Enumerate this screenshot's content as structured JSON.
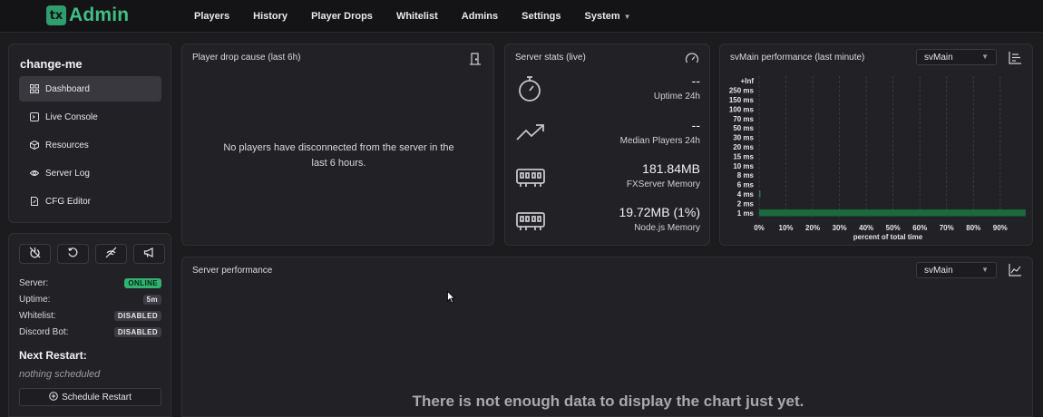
{
  "brand": {
    "mark": "tx",
    "name": "Admin",
    "color": "#3fbf85"
  },
  "nav": [
    {
      "label": "Players"
    },
    {
      "label": "History"
    },
    {
      "label": "Player Drops"
    },
    {
      "label": "Whitelist"
    },
    {
      "label": "Admins"
    },
    {
      "label": "Settings"
    },
    {
      "label": "System",
      "has_dropdown": true
    }
  ],
  "sidebar": {
    "server_name": "change-me",
    "items": [
      {
        "label": "Dashboard",
        "icon": "dashboard-icon",
        "active": true
      },
      {
        "label": "Live Console",
        "icon": "console-icon"
      },
      {
        "label": "Resources",
        "icon": "cube-icon"
      },
      {
        "label": "Server Log",
        "icon": "eye-icon"
      },
      {
        "label": "CFG Editor",
        "icon": "file-edit-icon"
      }
    ]
  },
  "status": {
    "controls": [
      "power-off-icon",
      "restart-icon",
      "signal-off-icon",
      "megaphone-icon"
    ],
    "rows": [
      {
        "label": "Server:",
        "value": "ONLINE",
        "style": "online"
      },
      {
        "label": "Uptime:",
        "value": "5m",
        "style": "gray"
      },
      {
        "label": "Whitelist:",
        "value": "DISABLED",
        "style": "gray"
      },
      {
        "label": "Discord Bot:",
        "value": "DISABLED",
        "style": "gray"
      }
    ],
    "next_restart_title": "Next Restart:",
    "next_restart_value": "nothing scheduled",
    "schedule_button": "Schedule Restart"
  },
  "drops": {
    "title": "Player drop cause (last 6h)",
    "empty_message": "No players have disconnected from the server in the last 6 hours."
  },
  "stats": {
    "title": "Server stats (live)",
    "items": [
      {
        "value": "--",
        "label": "Uptime 24h",
        "icon": "stopwatch-icon"
      },
      {
        "value": "--",
        "label": "Median Players 24h",
        "icon": "trending-up-icon"
      },
      {
        "value": "181.84MB",
        "label": "FXServer Memory",
        "icon": "memory-icon"
      },
      {
        "value": "19.72MB (1%)",
        "label": "Node.js Memory",
        "icon": "memory-icon"
      }
    ]
  },
  "perf": {
    "title": "svMain performance (last minute)",
    "thread": "svMain"
  },
  "chart_data": {
    "type": "bar",
    "orientation": "horizontal",
    "categories": [
      "+Inf",
      "250 ms",
      "150 ms",
      "100 ms",
      "70 ms",
      "50 ms",
      "30 ms",
      "20 ms",
      "15 ms",
      "10 ms",
      "8 ms",
      "6 ms",
      "4 ms",
      "2 ms",
      "1 ms"
    ],
    "values": [
      0,
      0,
      0,
      0,
      0,
      0,
      0,
      0,
      0,
      0,
      0,
      0,
      0.5,
      0,
      99.5
    ],
    "x_ticks": [
      "0%",
      "10%",
      "20%",
      "30%",
      "40%",
      "50%",
      "60%",
      "70%",
      "80%",
      "90%"
    ],
    "xlabel": "percent of total time",
    "xlim": [
      0,
      100
    ],
    "bar_color": "#1a6b3e",
    "grid": true
  },
  "server_perf": {
    "title": "Server performance",
    "thread": "svMain",
    "empty_message": "There is not enough data to display the chart just yet."
  }
}
